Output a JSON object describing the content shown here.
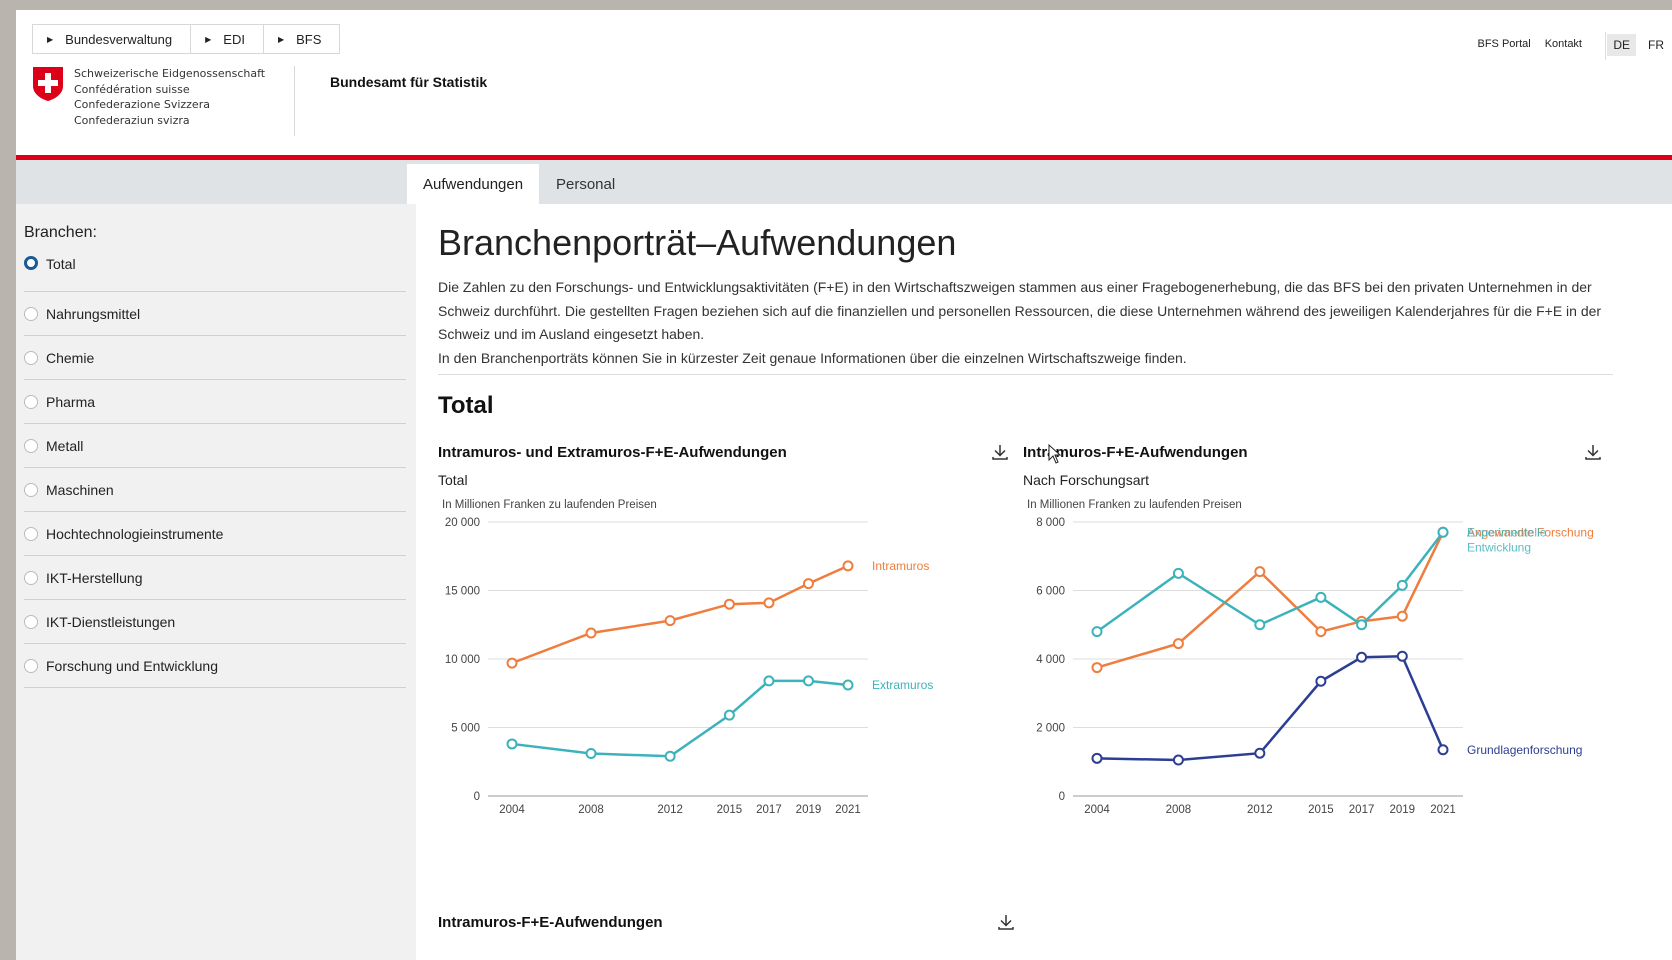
{
  "breadcrumb": [
    "Bundesverwaltung",
    "EDI",
    "BFS"
  ],
  "confederation": [
    "Schweizerische Eidgenossenschaft",
    "Confédération suisse",
    "Confederazione Svizzera",
    "Confederaziun svizra"
  ],
  "office_name": "Bundesamt für Statistik",
  "topnav": [
    "BFS Portal",
    "Kontakt"
  ],
  "languages": [
    "DE",
    "FR"
  ],
  "active_language": "DE",
  "tabs": [
    "Aufwendungen",
    "Personal"
  ],
  "active_tab": "Aufwendungen",
  "sidebar": {
    "title": "Branchen:",
    "items": [
      "Total",
      "Nahrungsmittel",
      "Chemie",
      "Pharma",
      "Metall",
      "Maschinen",
      "Hochtechnologieinstrumente",
      "IKT-Herstellung",
      "IKT-Dienstleistungen",
      "Forschung und Entwicklung"
    ],
    "selected": "Total"
  },
  "page_title": "Branchenporträt–Aufwendungen",
  "intro": [
    "Die Zahlen zu den Forschungs- und Entwicklungsaktivitäten (F+E) in den Wirtschaftszweigen stammen aus einer Fragebogenerhebung, die das BFS bei den privaten Unternehmen in der Schweiz durchführt. Die gestellten Fragen beziehen sich auf die finanziellen und personellen Ressourcen, die diese Unternehmen während des jeweiligen Kalenderjahres für die F+E in der Schweiz und im Ausland eingesetzt haben.",
    "In den Branchenporträts können Sie in kürzester Zeit genaue Informationen über die einzelnen Wirtschaftszweige finden."
  ],
  "section_title": "Total",
  "bottom_chart_title": "Intramuros-F+E-Aufwendungen",
  "colors": {
    "orange": "#ee7d3e",
    "teal": "#3cb2bb",
    "navy": "#2c3e94",
    "red": "#dc0018"
  },
  "chart_data": [
    {
      "type": "line",
      "title": "Intramuros- und Extramuros-F+E-Aufwendungen",
      "subtitle": "Total",
      "ylabel": "In Millionen Franken zu laufenden Preisen",
      "x": [
        2004,
        2008,
        2012,
        2015,
        2017,
        2019,
        2021
      ],
      "ylim": [
        0,
        20000
      ],
      "yticks": [
        0,
        5000,
        10000,
        15000,
        20000
      ],
      "ytick_labels": [
        "0",
        "5 000",
        "10 000",
        "15 000",
        "20 000"
      ],
      "series": [
        {
          "name": "Intramuros",
          "color": "#ee7d3e",
          "values": [
            9700,
            11900,
            12800,
            14000,
            14100,
            15500,
            16800
          ]
        },
        {
          "name": "Extramuros",
          "color": "#3cb2bb",
          "values": [
            3800,
            3100,
            2900,
            5900,
            8400,
            8400,
            8100
          ]
        }
      ],
      "grid": "horizontal",
      "legend": "line-end labels"
    },
    {
      "type": "line",
      "title": "Intramuros-F+E-Aufwendungen",
      "subtitle": "Nach Forschungsart",
      "ylabel": "In Millionen Franken zu laufenden Preisen",
      "x": [
        2004,
        2008,
        2012,
        2015,
        2017,
        2019,
        2021
      ],
      "ylim": [
        0,
        8000
      ],
      "yticks": [
        0,
        2000,
        4000,
        6000,
        8000
      ],
      "ytick_labels": [
        "0",
        "2 000",
        "4 000",
        "6 000",
        "8 000"
      ],
      "series": [
        {
          "name": "Angewandte Forschung",
          "color": "#ee7d3e",
          "values": [
            3750,
            4450,
            6550,
            4800,
            5100,
            5250,
            7700
          ]
        },
        {
          "name": "Experimentelle Entwicklung",
          "color": "#3cb2bb",
          "values": [
            4800,
            6500,
            5000,
            5800,
            5000,
            6150,
            7700
          ]
        },
        {
          "name": "Grundlagenforschung",
          "color": "#2c3e94",
          "values": [
            1100,
            1050,
            1250,
            3350,
            4050,
            4080,
            1350
          ]
        }
      ],
      "grid": "horizontal",
      "legend": "line-end labels"
    }
  ]
}
